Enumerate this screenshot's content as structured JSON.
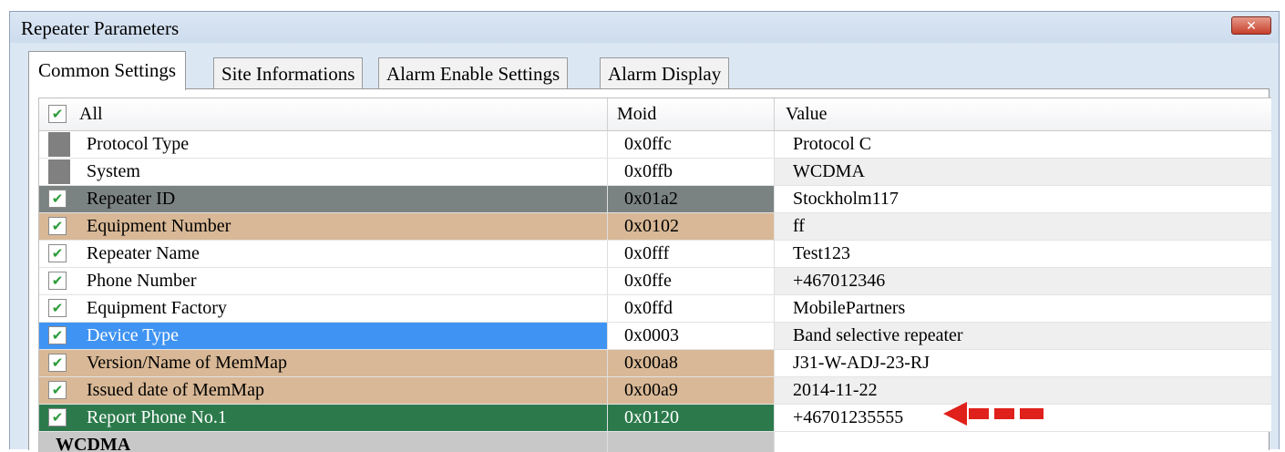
{
  "window": {
    "title": "Repeater Parameters",
    "close_glyph": "✕"
  },
  "tabs": [
    {
      "label": "Common Settings",
      "active": true
    },
    {
      "label": "Site Informations",
      "active": false
    },
    {
      "label": "Alarm Enable Settings",
      "active": false
    },
    {
      "label": "Alarm Display",
      "active": false
    }
  ],
  "table": {
    "headers": {
      "all": "All",
      "moid": "Moid",
      "value": "Value"
    },
    "rows": [
      {
        "name": "Protocol Type",
        "moid": "0x0ffc",
        "value": "Protocol C",
        "checked": false,
        "style": "plain"
      },
      {
        "name": "System",
        "moid": "0x0ffb",
        "value": "WCDMA",
        "checked": false,
        "style": "plain"
      },
      {
        "name": "Repeater ID",
        "moid": "0x01a2",
        "value": "Stockholm117",
        "checked": true,
        "style": "gray"
      },
      {
        "name": "Equipment Number",
        "moid": "0x0102",
        "value": "ff",
        "checked": true,
        "style": "tan"
      },
      {
        "name": "Repeater Name",
        "moid": "0x0fff",
        "value": "Test123",
        "checked": true,
        "style": "plain"
      },
      {
        "name": "Phone Number",
        "moid": "0x0ffe",
        "value": "+467012346",
        "checked": true,
        "style": "plain"
      },
      {
        "name": "Equipment Factory",
        "moid": "0x0ffd",
        "value": "MobilePartners",
        "checked": true,
        "style": "plain"
      },
      {
        "name": "Device Type",
        "moid": "0x0003",
        "value": "Band selective repeater",
        "checked": true,
        "style": "selected"
      },
      {
        "name": "Version/Name of MemMap",
        "moid": "0x00a8",
        "value": "J31-W-ADJ-23-RJ",
        "checked": true,
        "style": "tan"
      },
      {
        "name": "Issued date of MemMap",
        "moid": "0x00a9",
        "value": "2014-11-22",
        "checked": true,
        "style": "tan"
      },
      {
        "name": "Report Phone No.1",
        "moid": "0x0120",
        "value": "+46701235555",
        "checked": true,
        "style": "green"
      }
    ],
    "group_row": {
      "label": "WCDMA"
    }
  },
  "colors": {
    "gray_row": "#7b8382",
    "tan_row": "#d8b896",
    "selected_row": "#3f93f2",
    "green_row": "#2c7a4c",
    "group_row": "#c8c8c8",
    "alt_value_bg": "#efefef",
    "arrow": "#e0201b"
  },
  "annotation": {
    "icon": "red-dashed-arrow-icon"
  }
}
